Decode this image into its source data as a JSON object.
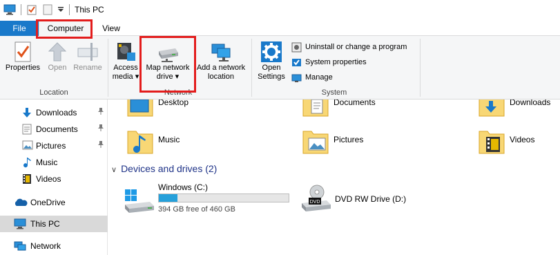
{
  "window": {
    "title": "This PC"
  },
  "tabs": {
    "file": "File",
    "computer": "Computer",
    "view": "View"
  },
  "ribbon": {
    "location": {
      "label": "Location",
      "properties": "Properties",
      "open": "Open",
      "rename": "Rename"
    },
    "network": {
      "label": "Network",
      "access_media": [
        "Access",
        "media ▾"
      ],
      "map_network_drive": [
        "Map network",
        "drive ▾"
      ],
      "add_network_location": [
        "Add a network",
        "location"
      ]
    },
    "system": {
      "label": "System",
      "open_settings": [
        "Open",
        "Settings"
      ],
      "uninstall": "Uninstall or change a program",
      "system_properties": "System properties",
      "manage": "Manage"
    }
  },
  "nav": {
    "items": [
      {
        "label": "Downloads",
        "icon": "download-icon",
        "pinned": true
      },
      {
        "label": "Documents",
        "icon": "documents-icon",
        "pinned": true
      },
      {
        "label": "Pictures",
        "icon": "pictures-icon",
        "pinned": true
      },
      {
        "label": "Music",
        "icon": "music-icon",
        "pinned": false
      },
      {
        "label": "Videos",
        "icon": "videos-icon",
        "pinned": false
      },
      {
        "label": "OneDrive",
        "icon": "cloud-icon",
        "pinned": false
      },
      {
        "label": "This PC",
        "icon": "computer-icon",
        "pinned": false,
        "selected": true
      },
      {
        "label": "Network",
        "icon": "network-icon",
        "pinned": false
      }
    ]
  },
  "folders": [
    {
      "label": "Desktop"
    },
    {
      "label": "Documents"
    },
    {
      "label": "Downloads"
    },
    {
      "label": "Music"
    },
    {
      "label": "Pictures"
    },
    {
      "label": "Videos"
    }
  ],
  "devices": {
    "header": "Devices and drives (2)",
    "drives": [
      {
        "name": "Windows (C:)",
        "free_text": "394 GB free of 460 GB",
        "used_fraction": 0.143
      },
      {
        "name": "DVD RW Drive (D:)"
      }
    ]
  },
  "colors": {
    "accent": "#1979ca",
    "highlight": "#e31c1c",
    "drive_bar": "#26a0da",
    "folder": "#f8d775"
  }
}
